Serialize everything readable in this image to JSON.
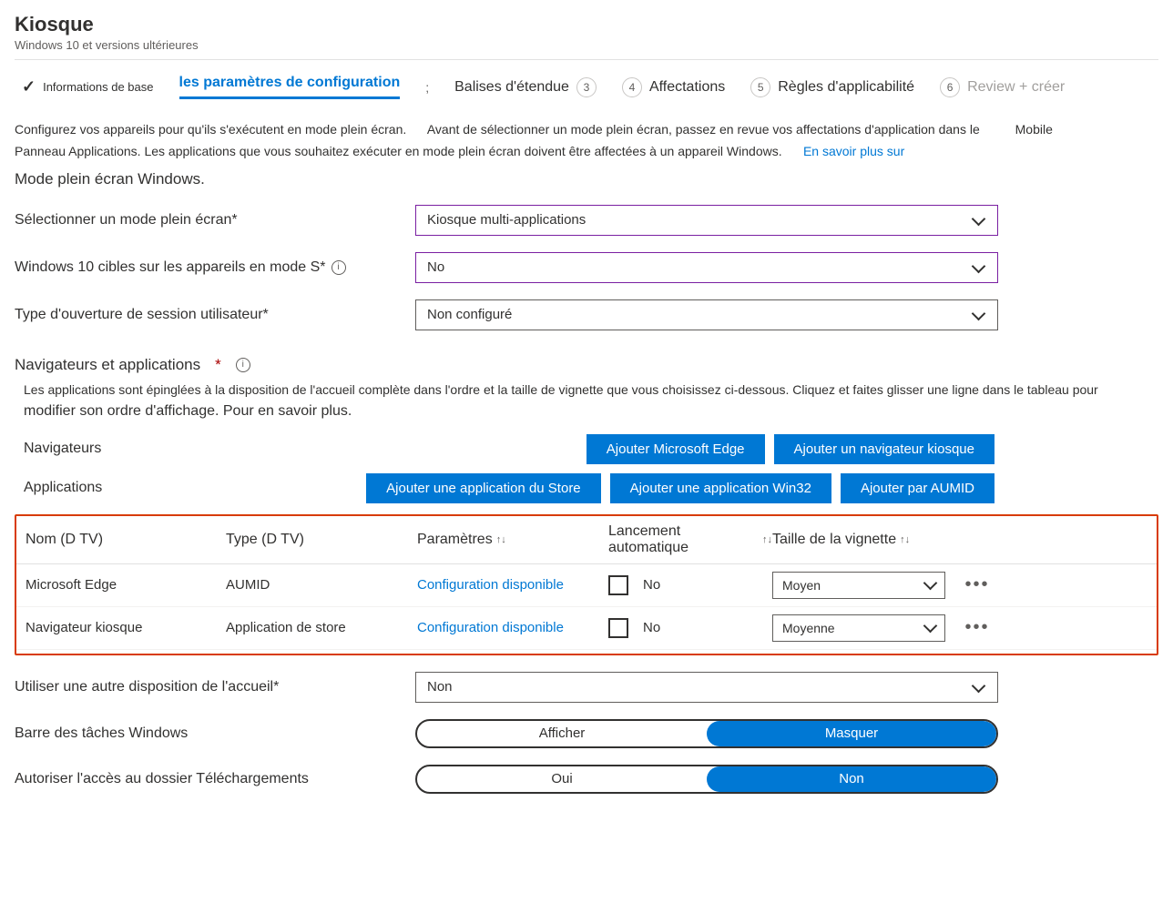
{
  "header": {
    "title": "Kiosque",
    "subtitle": "Windows 10 et versions ultérieures"
  },
  "wizard": {
    "step1": "Informations de base",
    "step2": "les paramètres de configuration",
    "step3_badge": "3",
    "step3": "Balises d'étendue",
    "step4_badge": "4",
    "step4": "Affectations",
    "step5_badge": "5",
    "step5": "Règles d'applicabilité",
    "step6_badge": "6",
    "step6": "Review + créer"
  },
  "intro": {
    "line1a": "Configurez vos appareils pour qu'ils s'exécutent en mode plein écran.",
    "line1b": "Avant de sélectionner un mode plein écran, passez en revue vos affectations d'application dans le",
    "line1c": "Mobile",
    "line2a": "Panneau Applications. Les applications que vous souhaitez exécuter en mode plein écran doivent être affectées à un appareil Windows.",
    "line2b": "En savoir plus sur",
    "line3": "Mode plein écran Windows."
  },
  "fields": {
    "mode_label": "Sélectionner un mode plein écran*",
    "mode_value": "Kiosque multi-applications",
    "w10s_label": "Windows 10 cibles sur les appareils en mode S*",
    "w10s_value": "No",
    "logon_label": "Type d'ouverture de session utilisateur*",
    "logon_value": "Non configuré"
  },
  "browsers": {
    "title": "Navigateurs et applications",
    "helper": "Les applications sont épinglées à la disposition de l'accueil complète dans l'ordre et la taille de vignette que vous choisissez ci-dessous. Cliquez et faites glisser une ligne dans le tableau pour",
    "helper2": "modifier son ordre d'affichage. Pour en savoir plus.",
    "nav_label": "Navigateurs",
    "add_edge": "Ajouter Microsoft Edge",
    "add_kiosk_browser": "Ajouter un navigateur kiosque",
    "apps_label": "Applications",
    "add_store": "Ajouter une application du Store",
    "add_win32": "Ajouter une application Win32",
    "add_aumid": "Ajouter par AUMID"
  },
  "table": {
    "col_name": "Nom (D TV)",
    "col_type": "Type (D TV)",
    "col_settings": "Paramètres",
    "col_autolaunch": "Lancement automatique",
    "col_tile": "Taille de la vignette",
    "rows": [
      {
        "name": "Microsoft Edge",
        "type": "AUMID",
        "settings": "Configuration disponible",
        "auto": "No",
        "tile": "Moyen"
      },
      {
        "name": "Navigateur kiosque",
        "type": "Application de store",
        "settings": "Configuration disponible",
        "auto": "No",
        "tile": "Moyenne"
      }
    ]
  },
  "bottom": {
    "alt_layout_label": "Utiliser une autre disposition de l'accueil*",
    "alt_layout_value": "Non",
    "taskbar_label": "Barre des tâches Windows",
    "taskbar_show": "Afficher",
    "taskbar_hide": "Masquer",
    "downloads_label": "Autoriser l'accès au dossier Téléchargements",
    "downloads_yes": "Oui",
    "downloads_no": "Non"
  }
}
